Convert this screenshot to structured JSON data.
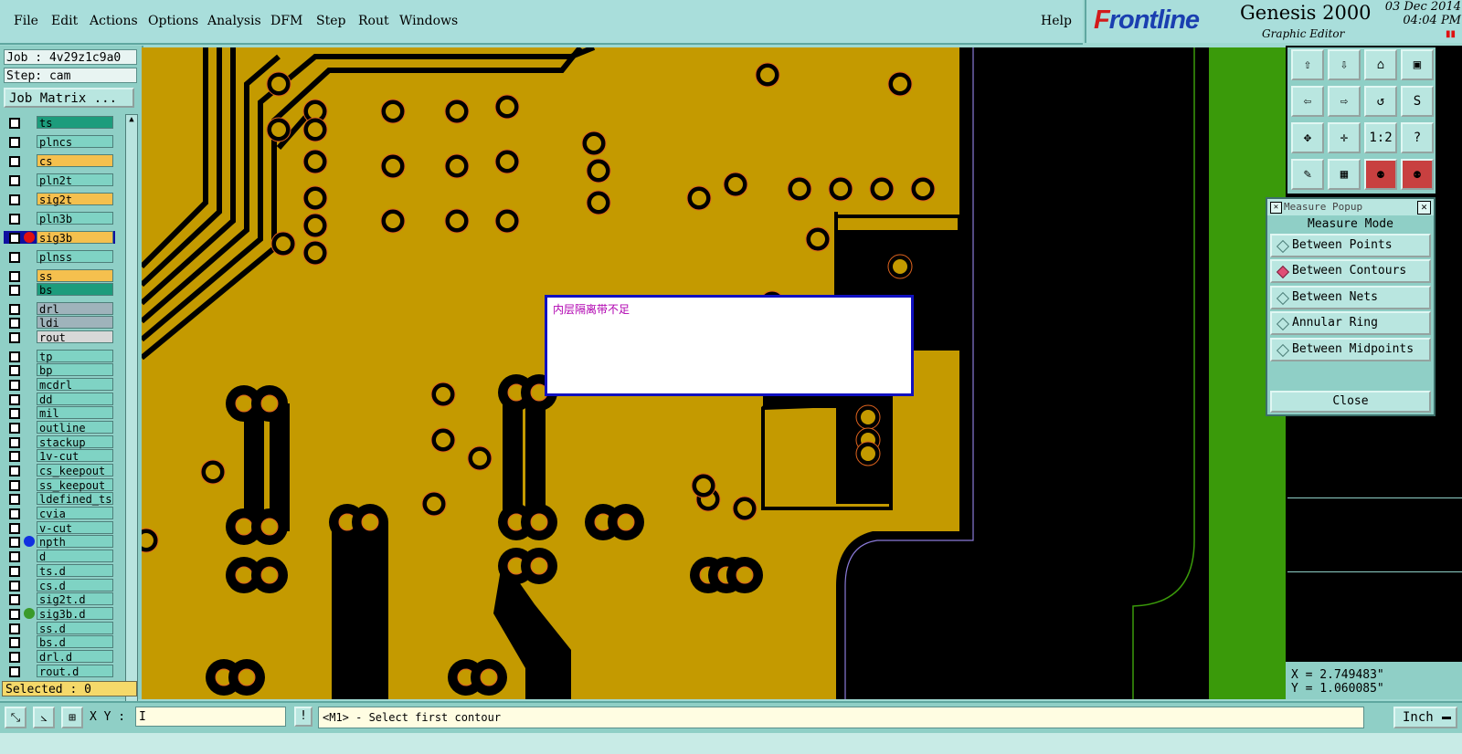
{
  "menubar": {
    "items": [
      "File",
      "Edit",
      "Actions",
      "Options",
      "Analysis",
      "DFM",
      "Step",
      "Rout",
      "Windows"
    ],
    "help": "Help"
  },
  "brand": {
    "logo_f": "F",
    "logo_rest": "rontline",
    "product": "Genesis 2000",
    "subtitle": "Graphic Editor",
    "date": "03 Dec 2014",
    "time": "04:04 PM"
  },
  "left_panel": {
    "job": "Job : 4v29z1c9a0",
    "step": "Step: cam",
    "job_matrix_button": "Job Matrix ...",
    "selected": "Selected : 0",
    "layers": [
      {
        "name": "ts",
        "color": "#1c9c7c"
      },
      {
        "name": "plncs",
        "color": "#7fd3c4"
      },
      {
        "name": "cs",
        "color": "#f5c04e"
      },
      {
        "name": "pln2t",
        "color": "#7fd3c4"
      },
      {
        "name": "sig2t",
        "color": "#f5c04e"
      },
      {
        "name": "pln3b",
        "color": "#7fd3c4"
      },
      {
        "name": "sig3b",
        "color": "#f5c04e",
        "active": true,
        "dot": "#e01010"
      },
      {
        "name": "plnss",
        "color": "#7fd3c4"
      },
      {
        "name": "ss",
        "color": "#f5c04e"
      },
      {
        "name": "bs",
        "color": "#1c9c7c"
      },
      {
        "name": "drl",
        "color": "#9fb3bb"
      },
      {
        "name": "ldi",
        "color": "#9fb3bb"
      },
      {
        "name": "rout",
        "color": "#d8d8d8"
      },
      {
        "name": "tp",
        "color": "#7fd3c4"
      },
      {
        "name": "bp",
        "color": "#7fd3c4"
      },
      {
        "name": "mcdrl",
        "color": "#7fd3c4"
      },
      {
        "name": "dd",
        "color": "#7fd3c4"
      },
      {
        "name": "mil",
        "color": "#7fd3c4"
      },
      {
        "name": "outline",
        "color": "#7fd3c4"
      },
      {
        "name": "stackup",
        "color": "#7fd3c4"
      },
      {
        "name": "1v-cut",
        "color": "#7fd3c4"
      },
      {
        "name": "cs_keepout",
        "color": "#7fd3c4"
      },
      {
        "name": "ss_keepout",
        "color": "#7fd3c4"
      },
      {
        "name": "ldefined_ts",
        "color": "#7fd3c4"
      },
      {
        "name": "cvia",
        "color": "#7fd3c4"
      },
      {
        "name": "v-cut",
        "color": "#7fd3c4"
      },
      {
        "name": "npth",
        "color": "#7fd3c4",
        "dot": "#1030e0"
      },
      {
        "name": "d",
        "color": "#7fd3c4"
      },
      {
        "name": "ts.d",
        "color": "#7fd3c4"
      },
      {
        "name": "cs.d",
        "color": "#7fd3c4"
      },
      {
        "name": "sig2t.d",
        "color": "#7fd3c4"
      },
      {
        "name": "sig3b.d",
        "color": "#7fd3c4",
        "dot": "#3a9a2a"
      },
      {
        "name": "ss.d",
        "color": "#7fd3c4"
      },
      {
        "name": "bs.d",
        "color": "#7fd3c4"
      },
      {
        "name": "drl.d",
        "color": "#7fd3c4"
      },
      {
        "name": "rout.d",
        "color": "#7fd3c4"
      }
    ]
  },
  "canvas": {
    "annotation_text": "内层隔离带不足",
    "colors": {
      "copper": "#c49a00",
      "background": "#000000",
      "trace": "#000000",
      "pad_ring": "#e0641e",
      "board_edge": "#3a9a0a"
    }
  },
  "toolbar": {
    "buttons": [
      "zoom-home",
      "zoom-in",
      "home",
      "zoom-window",
      "pan-left",
      "pan-right",
      "back",
      "redraw",
      "fit",
      "center",
      "1:2",
      "help",
      "palette",
      "grid",
      "layer-colors",
      "layer-colors-2"
    ],
    "ratio_label": "1:2",
    "help_label": "?"
  },
  "measure_popup": {
    "title": "Measure Popup",
    "mode_title": "Measure Mode",
    "modes": [
      "Between Points",
      "Between Contours",
      "Between Nets",
      "Annular Ring",
      "Between Midpoints"
    ],
    "selected_mode": "Between Contours",
    "close_label": "Close"
  },
  "coords": {
    "x": "X = 2.749483\"",
    "y": "Y = 1.060085\""
  },
  "bottom": {
    "xy_label": "X Y :",
    "xy_value": "I",
    "bang": "!",
    "status": "<M1> - Select first contour",
    "unit": "Inch"
  }
}
